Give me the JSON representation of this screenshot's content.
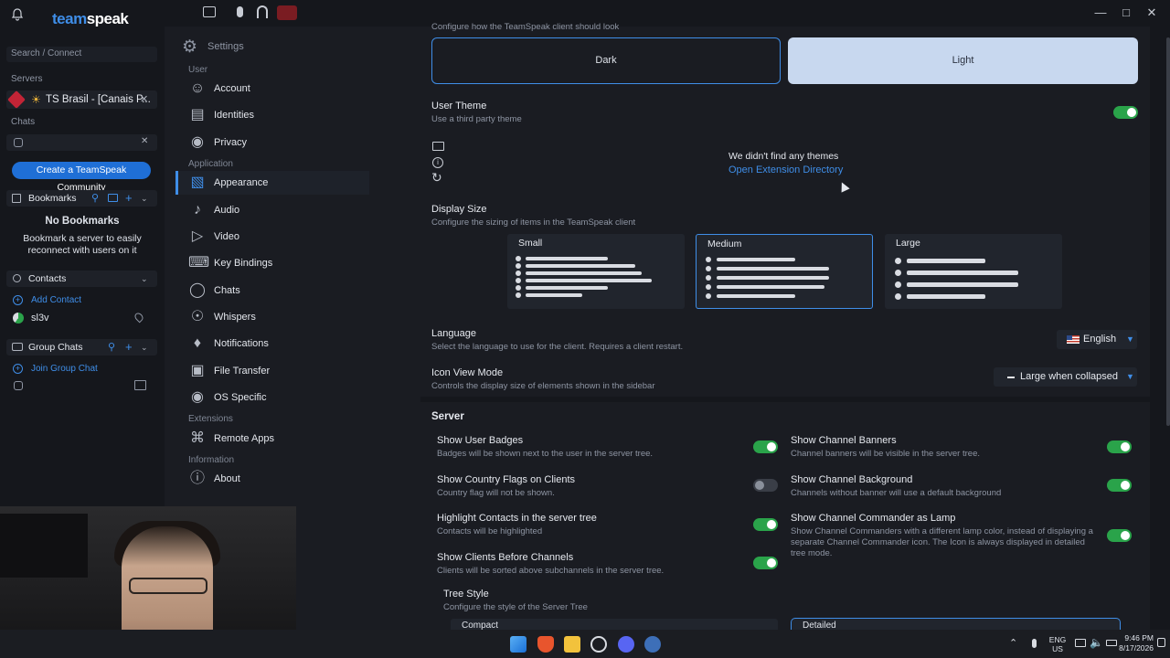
{
  "app": {
    "logo_part1": "team",
    "logo_part2": "speak"
  },
  "leftnav": {
    "search_placeholder": "Search / Connect",
    "servers_label": "Servers",
    "server_name": "TS Brasil - [Canais P...",
    "chats_label": "Chats",
    "create_community": "Create a TeamSpeak Community",
    "bookmarks_label": "Bookmarks",
    "no_bookmarks": "No Bookmarks",
    "bookmark_hint": "Bookmark a server to easily reconnect with users on it",
    "contacts_label": "Contacts",
    "add_contact": "Add Contact",
    "contact_name": "sl3v",
    "group_chats_label": "Group Chats",
    "join_group_chat": "Join Group Chat"
  },
  "settings_nav": {
    "title": "Settings",
    "sections": {
      "user": "User",
      "application": "Application",
      "extensions": "Extensions",
      "information": "Information"
    },
    "items": [
      {
        "label": "Account",
        "icon": "account-icon"
      },
      {
        "label": "Identities",
        "icon": "identities-icon"
      },
      {
        "label": "Privacy",
        "icon": "lock-icon"
      },
      {
        "label": "Appearance",
        "icon": "appearance-icon"
      },
      {
        "label": "Audio",
        "icon": "speaker-icon"
      },
      {
        "label": "Video",
        "icon": "video-icon"
      },
      {
        "label": "Key Bindings",
        "icon": "key-icon"
      },
      {
        "label": "Chats",
        "icon": "chat-icon"
      },
      {
        "label": "Whispers",
        "icon": "whisper-icon"
      },
      {
        "label": "Notifications",
        "icon": "bell-icon"
      },
      {
        "label": "File Transfer",
        "icon": "file-icon"
      },
      {
        "label": "OS Specific",
        "icon": "toggle-icon"
      },
      {
        "label": "Remote Apps",
        "icon": "remote-apps-icon"
      },
      {
        "label": "About",
        "icon": "info-icon"
      }
    ]
  },
  "appearance": {
    "theme_hint": "Configure how the TeamSpeak client should look",
    "dark_label": "Dark",
    "light_label": "Light",
    "user_theme": {
      "title": "User Theme",
      "desc": "Use a third party theme",
      "enabled": true
    },
    "no_themes": "We didn't find any themes",
    "open_ext": "Open Extension Directory",
    "display_size": {
      "title": "Display Size",
      "desc": "Configure the sizing of items in the TeamSpeak client",
      "options": [
        "Small",
        "Medium",
        "Large"
      ],
      "selected": "Medium"
    },
    "language": {
      "title": "Language",
      "desc": "Select the language to use for the client. Requires a client restart.",
      "value": "English"
    },
    "icon_view": {
      "title": "Icon View Mode",
      "desc": "Controls the display size of elements shown in the sidebar",
      "value": "Large when collapsed"
    }
  },
  "server": {
    "title": "Server",
    "left": [
      {
        "title": "Show User Badges",
        "desc": "Badges will be shown next to the user in the server tree.",
        "on": true
      },
      {
        "title": "Show Country Flags on Clients",
        "desc": "Country flag will not be shown.",
        "on": false
      },
      {
        "title": "Highlight Contacts in the server tree",
        "desc": "Contacts will be highlighted",
        "on": true
      },
      {
        "title": "Show Clients Before Channels",
        "desc": "Clients will be sorted above subchannels in the server tree.",
        "on": true
      }
    ],
    "right": [
      {
        "title": "Show Channel Banners",
        "desc": "Channel banners will be visible in the server tree.",
        "on": true
      },
      {
        "title": "Show Channel Background",
        "desc": "Channels without banner will use a default background",
        "on": true
      },
      {
        "title": "Show Channel Commander as Lamp",
        "desc": "Show Channel Commanders with a different lamp color, instead of displaying a separate Channel Commander icon. The Icon is always displayed in detailed tree mode.",
        "on": true
      }
    ],
    "tree_style": {
      "title": "Tree Style",
      "desc": "Configure the style of the Server Tree",
      "options": [
        "Compact",
        "Detailed"
      ],
      "selected": "Detailed"
    }
  },
  "taskbar": {
    "lang": "ENG",
    "region": "US",
    "time": "9:46 PM",
    "date": "8/17/2026"
  }
}
